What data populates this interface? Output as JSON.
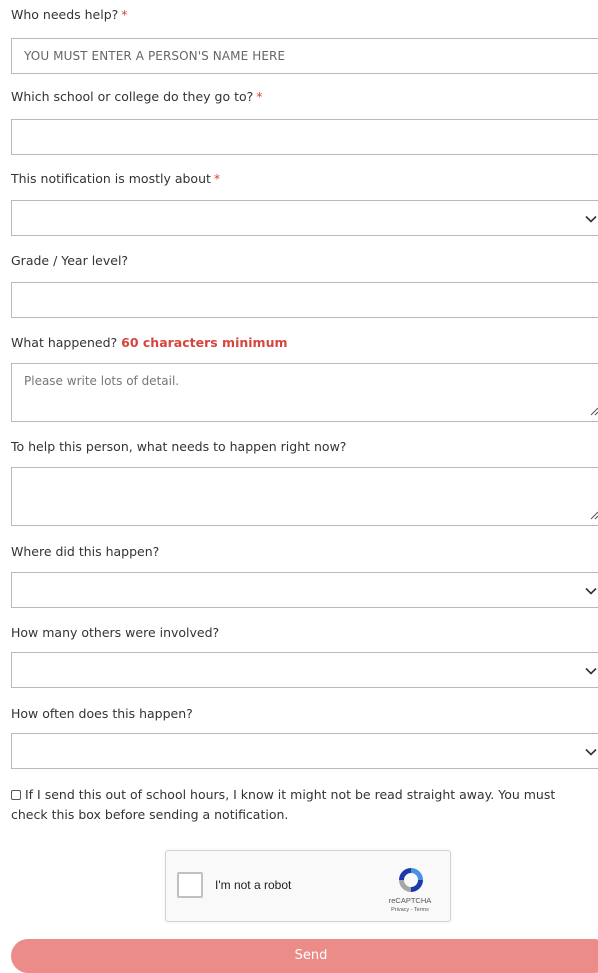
{
  "required_marker": "*",
  "fields": {
    "who": {
      "label": "Who needs help?",
      "placeholder": "YOU MUST ENTER A PERSON'S NAME HERE"
    },
    "school": {
      "label": "Which school or college do they go to?"
    },
    "notification": {
      "label": "This notification is mostly about"
    },
    "grade": {
      "label": "Grade / Year level?"
    },
    "what": {
      "label": "What happened?",
      "note": "60 characters minimum",
      "placeholder": "Please write lots of detail."
    },
    "help_now": {
      "label": "To help this person, what needs to happen right now?"
    },
    "where": {
      "label": "Where did this happen?"
    },
    "others": {
      "label": "How many others were involved?"
    },
    "often": {
      "label": "How often does this happen?"
    }
  },
  "consent": {
    "text": "If I send this out of school hours, I know it might not be read straight away. You must check this box before sending a notification."
  },
  "recaptcha": {
    "label": "I'm not a robot",
    "brand": "reCAPTCHA",
    "terms": "Privacy - Terms"
  },
  "send_label": "Send",
  "colors": {
    "required": "#d6453d",
    "send_button": "#ec8c88",
    "border": "#b9b9b9"
  },
  "icons": {
    "select": "chevron-down-icon",
    "textarea": "resize-grip-icon",
    "recaptcha": "recaptcha-logo-icon"
  }
}
